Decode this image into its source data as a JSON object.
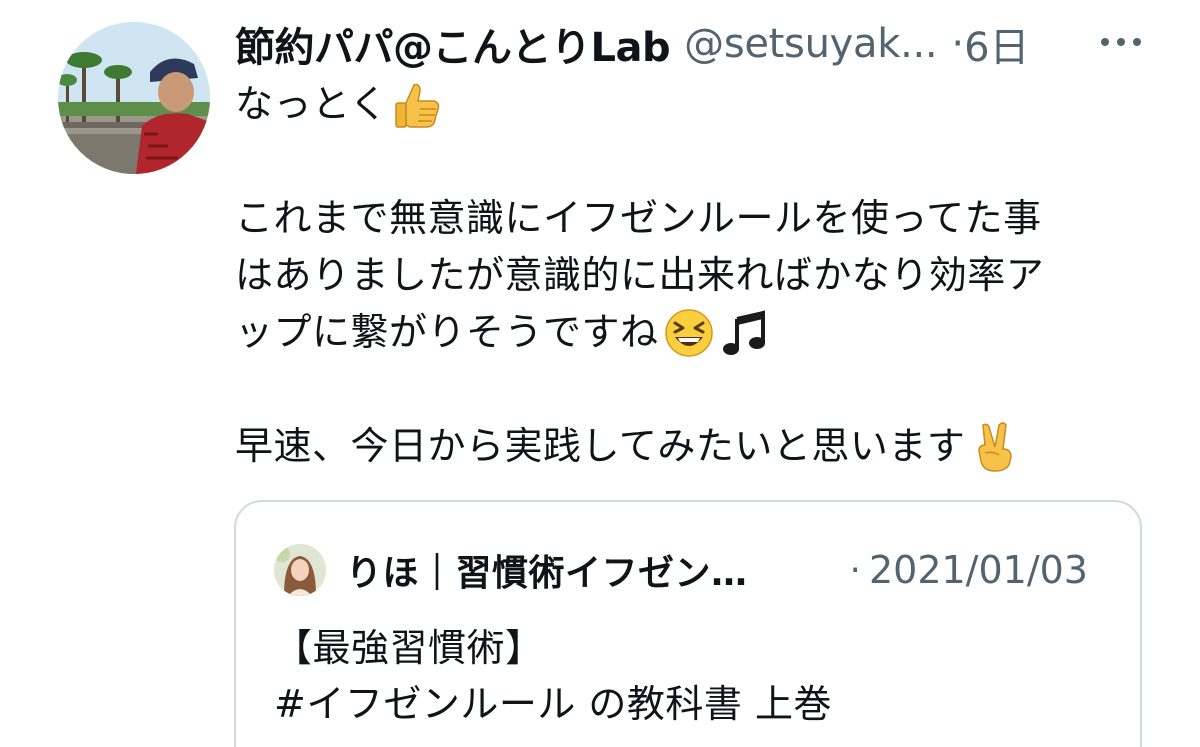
{
  "tweet": {
    "display_name": "節約パパ@こんとりLab",
    "handle": "@setsuyak...",
    "separator": "·",
    "time": "6日",
    "more_icon": "more-dots-icon",
    "body": {
      "line1": "なっとく",
      "line2": "これまで無意識にイフゼンルールを使ってた事",
      "line3": "はありましたが意識的に出来ればかなり効率ア",
      "line4": "ップに繋がりそうですね",
      "line5": "早速、今日から実践してみたいと思います"
    },
    "emojis": {
      "thumbs_up": "thumbs-up-icon",
      "grin": "grinning-squinting-icon",
      "music": "music-notes-icon",
      "victory": "victory-hand-icon"
    }
  },
  "quote": {
    "name": "りほ｜習慣術イフゼン…",
    "separator": "·",
    "date": "2021/01/03",
    "line1": "【最強習慣術】",
    "line2": "#イフゼンルール の教科書 上巻"
  }
}
